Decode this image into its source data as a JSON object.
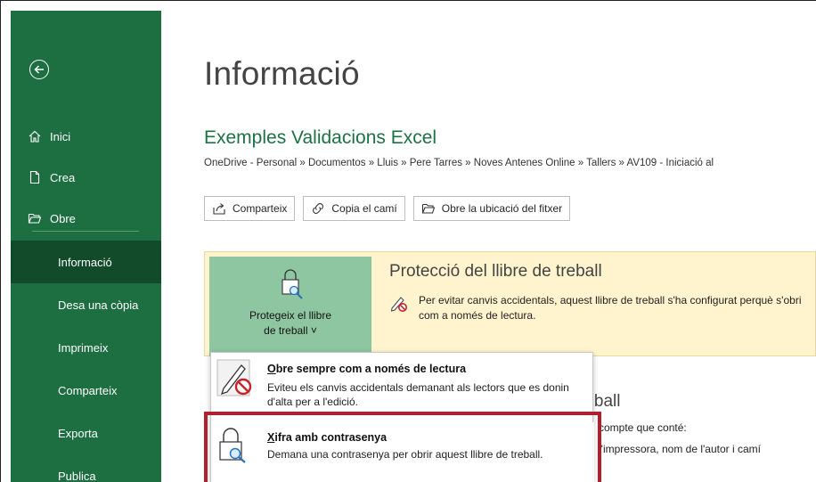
{
  "sidebar": {
    "back_icon": "back-arrow-circle-icon",
    "top_items": [
      {
        "label": "Inici",
        "icon": "home-icon"
      },
      {
        "label": "Crea",
        "icon": "new-document-icon"
      },
      {
        "label": "Obre",
        "icon": "open-folder-icon"
      }
    ],
    "bottom_items": [
      {
        "label": "Informació",
        "active": true
      },
      {
        "label": "Desa una còpia"
      },
      {
        "label": "Imprimeix"
      },
      {
        "label": "Comparteix"
      },
      {
        "label": "Exporta"
      },
      {
        "label": "Publica"
      }
    ]
  },
  "main": {
    "title": "Informació",
    "doc_name": "Exemples Validacions Excel",
    "breadcrumb": "OneDrive - Personal » Documentos » Lluis » Pere Tarres » Noves Antenes Online » Tallers » AV109 - Iniciació al",
    "buttons": {
      "share": "Comparteix",
      "copy_path": "Copia el camí",
      "open_location": "Obre la ubicació del fitxer"
    }
  },
  "protection": {
    "button_label_line1": "Protegeix el llibre",
    "button_label_line2": "de treball ˅",
    "title": "Protecció del llibre de treball",
    "description": "Per evitar canvis accidentals, aquest llibre de treball s'ha configurat perquè s'obri com a només de lectura."
  },
  "properties": {
    "title": "reball",
    "line1": "compte que conté:",
    "line2": "l'impressora, nom de l'autor i camí"
  },
  "menu": {
    "items": [
      {
        "title_underlined": "O",
        "title_rest": "bre sempre com a només de lectura",
        "description": "Eviteu els canvis accidentals demanant als lectors que es donin d'alta per a l'edició."
      },
      {
        "title_underlined": "X",
        "title_rest": "ifra amb contrasenya",
        "description": "Demana una contrasenya per obrir aquest llibre de treball."
      }
    ]
  },
  "colors": {
    "sidebar_green": "#1d6f42",
    "sidebar_active": "#124b2a",
    "accent_green": "#1e7145",
    "protect_button": "#8ec6a2",
    "protect_card": "#fff4ce",
    "highlight_red": "#b01f2e"
  }
}
